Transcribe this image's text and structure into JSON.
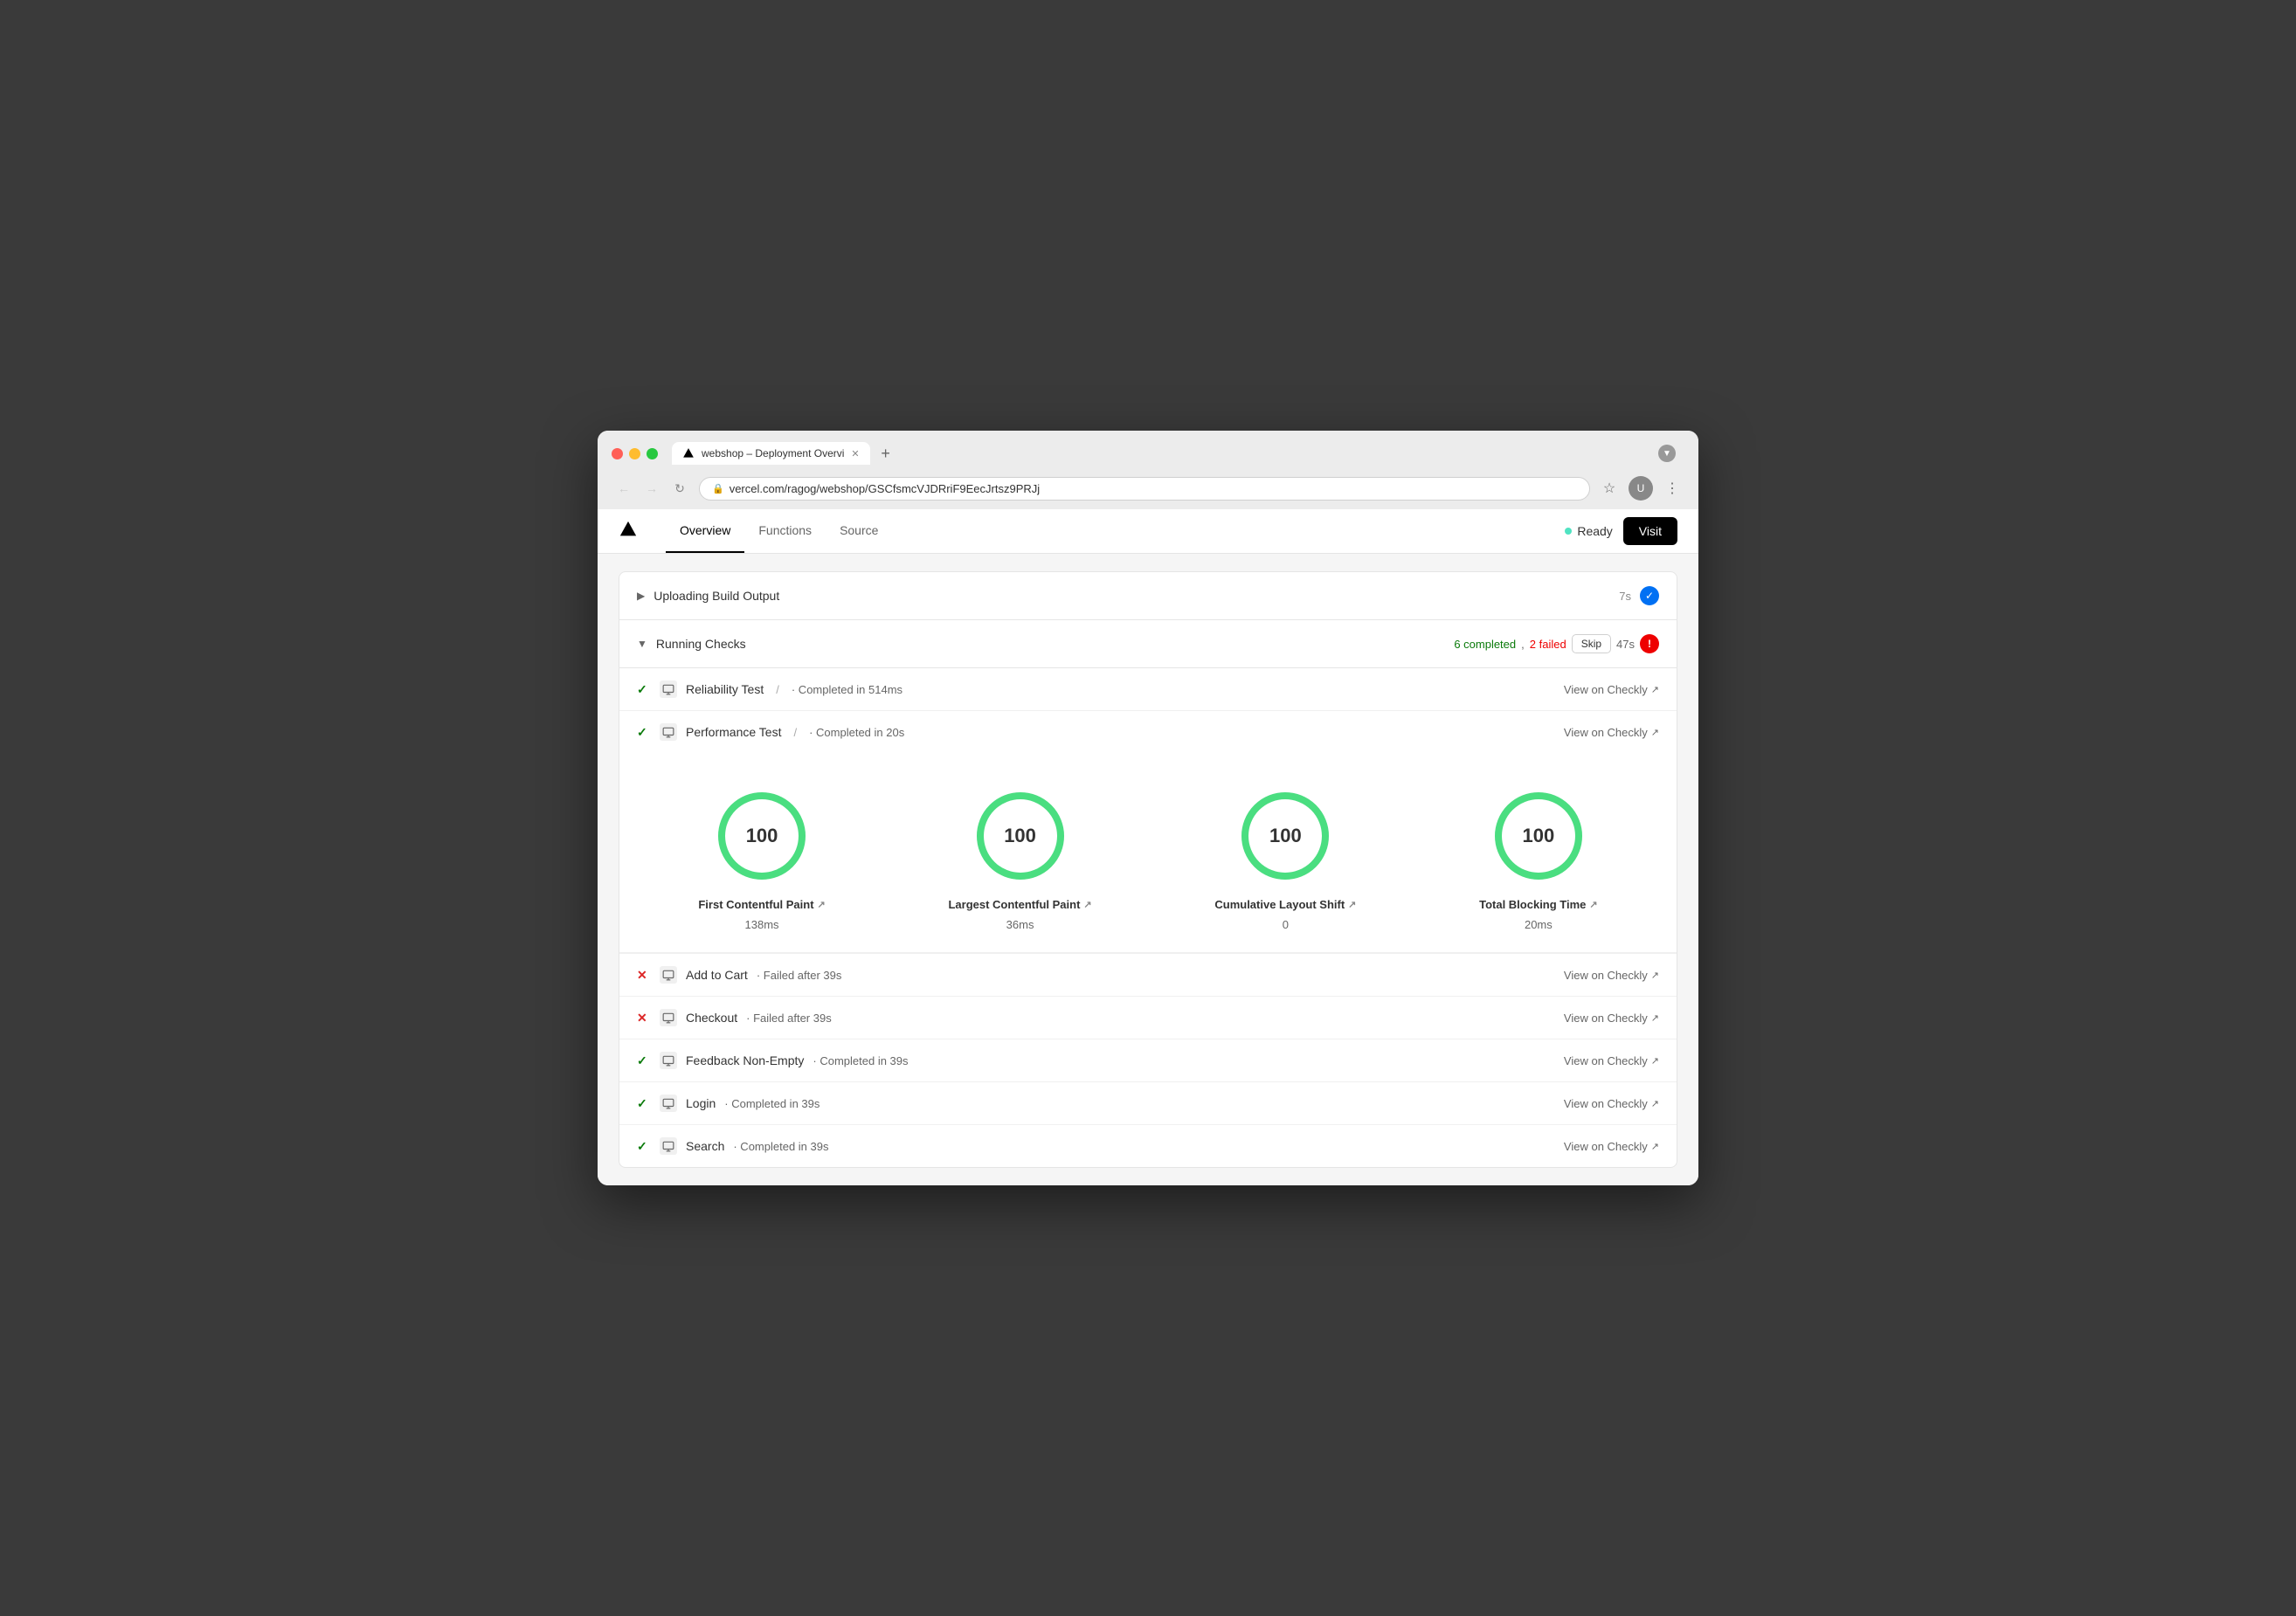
{
  "browser": {
    "tab_title": "webshop – Deployment Overvi",
    "url": "vercel.com/ragog/webshop/GSCfsmcVJDRriF9EecJrtsz9PRJj",
    "new_tab_label": "+"
  },
  "header": {
    "logo_alt": "Vercel",
    "nav_tabs": [
      {
        "label": "Overview",
        "active": true
      },
      {
        "label": "Functions",
        "active": false
      },
      {
        "label": "Source",
        "active": false
      }
    ],
    "status_label": "Ready",
    "visit_button": "Visit"
  },
  "uploading_build": {
    "title": "Uploading Build Output",
    "time": "7s",
    "status": "success"
  },
  "running_checks": {
    "title": "Running Checks",
    "completed_count": "6 completed",
    "failed_count": "2 failed",
    "time": "47s",
    "skip_label": "Skip",
    "checks": [
      {
        "id": "reliability",
        "status": "success",
        "name": "Reliability Test",
        "separator": "/",
        "detail": "Completed in 514ms",
        "view_link": "View on Checkly"
      },
      {
        "id": "performance",
        "status": "success",
        "name": "Performance Test",
        "separator": "/",
        "detail": "Completed in 20s",
        "view_link": "View on Checkly",
        "has_metrics": true
      },
      {
        "id": "add-to-cart",
        "status": "fail",
        "name": "Add to Cart",
        "detail": "Failed after 39s",
        "view_link": "View on Checkly"
      },
      {
        "id": "checkout",
        "status": "fail",
        "name": "Checkout",
        "detail": "Failed after 39s",
        "view_link": "View on Checkly"
      },
      {
        "id": "feedback",
        "status": "success",
        "name": "Feedback Non-Empty",
        "detail": "Completed in 39s",
        "view_link": "View on Checkly"
      },
      {
        "id": "login",
        "status": "success",
        "name": "Login",
        "detail": "Completed in 39s",
        "view_link": "View on Checkly"
      },
      {
        "id": "search",
        "status": "success",
        "name": "Search",
        "detail": "Completed in 39s",
        "view_link": "View on Checkly"
      }
    ]
  },
  "metrics": [
    {
      "label": "First Contentful Paint",
      "value": "138ms",
      "score": 100,
      "id": "fcp"
    },
    {
      "label": "Largest Contentful Paint",
      "value": "36ms",
      "score": 100,
      "id": "lcp"
    },
    {
      "label": "Cumulative Layout Shift",
      "value": "0",
      "score": 100,
      "id": "cls"
    },
    {
      "label": "Total Blocking Time",
      "value": "20ms",
      "score": 100,
      "id": "tbt"
    }
  ],
  "colors": {
    "green_gauge": "#4ade80",
    "gauge_bg": "#e5e7eb",
    "success_color": "#16a34a",
    "fail_color": "#dc2626",
    "blue_check": "#2563eb"
  }
}
